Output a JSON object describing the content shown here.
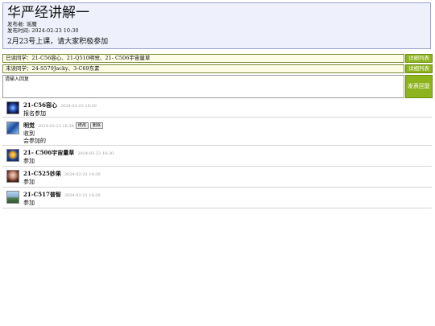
{
  "notice": {
    "title": "华严经讲解一",
    "author_line": "发布者: 谣魔",
    "time_line": "发布时间: 2024-02-23 10:30",
    "body": "2月23号上课，请大家积极参加"
  },
  "signed_row": {
    "text": "已读同学：21-C56容心、21-Q510明觉、21- C506宇宙量草",
    "button": "详细列表"
  },
  "unsigned_row": {
    "text": "未读同学：24-S579Jacky、3-C69东素",
    "button": "详细列表"
  },
  "reply": {
    "placeholder": "请输入回复",
    "post_button": "发表回复"
  },
  "comments": [
    {
      "name": "21-C56容心",
      "time": "2024-02-23 10:30",
      "lines": [
        "报名参加"
      ],
      "avatar": "avatar-icon"
    },
    {
      "name": "明觉",
      "time": "2024-02-23 16:34",
      "lines": [
        "收到",
        "会参加的"
      ],
      "edit": "修改",
      "delete": "删除",
      "avatar": "avatar-icon"
    },
    {
      "name": "21- C506宇宙量草",
      "time": "2024-02-23 10:30",
      "lines": [
        "参加"
      ],
      "avatar": "avatar-icon"
    },
    {
      "name": "21-C525妙果",
      "time": "2024-02-22 10:30",
      "lines": [
        "参加"
      ],
      "avatar": "avatar-icon"
    },
    {
      "name": "21-C517普智",
      "time": "2024-02-21 10:30",
      "lines": [
        "参加"
      ],
      "avatar": "avatar-icon"
    }
  ]
}
